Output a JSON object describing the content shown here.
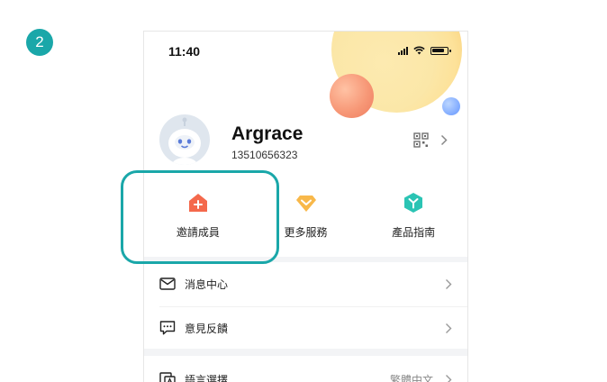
{
  "step_number": "2",
  "status_bar": {
    "time": "11:40"
  },
  "profile": {
    "name": "Argrace",
    "phone": "13510656323"
  },
  "quick_actions": [
    {
      "label": "邀請成員",
      "icon": "add-home-icon",
      "color": "#f4694c"
    },
    {
      "label": "更多服務",
      "icon": "diamond-icon",
      "color": "#f8b84a"
    },
    {
      "label": "產品指南",
      "icon": "guide-cube-icon",
      "color": "#2bc4b4"
    }
  ],
  "menu": {
    "messages": "消息中心",
    "feedback": "意見反饋",
    "language": "語言選擇",
    "language_value": "繁體中文"
  },
  "colors": {
    "accent": "#1aa7a9",
    "text": "#222222",
    "secondary": "#888888"
  }
}
